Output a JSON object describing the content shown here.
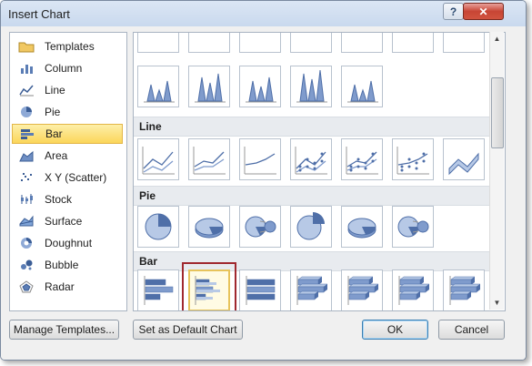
{
  "window": {
    "title": "Insert Chart",
    "help_label": "?",
    "close_label": "✕"
  },
  "categories": [
    {
      "label": "Templates",
      "icon": "folder-icon"
    },
    {
      "label": "Column",
      "icon": "column-chart-icon"
    },
    {
      "label": "Line",
      "icon": "line-chart-icon"
    },
    {
      "label": "Pie",
      "icon": "pie-chart-icon"
    },
    {
      "label": "Bar",
      "icon": "bar-chart-icon",
      "selected": true
    },
    {
      "label": "Area",
      "icon": "area-chart-icon"
    },
    {
      "label": "X Y (Scatter)",
      "icon": "scatter-chart-icon"
    },
    {
      "label": "Stock",
      "icon": "stock-chart-icon"
    },
    {
      "label": "Surface",
      "icon": "surface-chart-icon"
    },
    {
      "label": "Doughnut",
      "icon": "doughnut-chart-icon"
    },
    {
      "label": "Bubble",
      "icon": "bubble-chart-icon"
    },
    {
      "label": "Radar",
      "icon": "radar-chart-icon"
    }
  ],
  "sections": {
    "line": "Line",
    "pie": "Pie",
    "bar": "Bar"
  },
  "buttons": {
    "manage_templates": "Manage Templates...",
    "set_default": "Set as Default Chart",
    "ok": "OK",
    "cancel": "Cancel"
  },
  "colors": {
    "accent": "#4f6fa8",
    "selection": "#fbd65a",
    "highlight_border": "#a0282e"
  }
}
